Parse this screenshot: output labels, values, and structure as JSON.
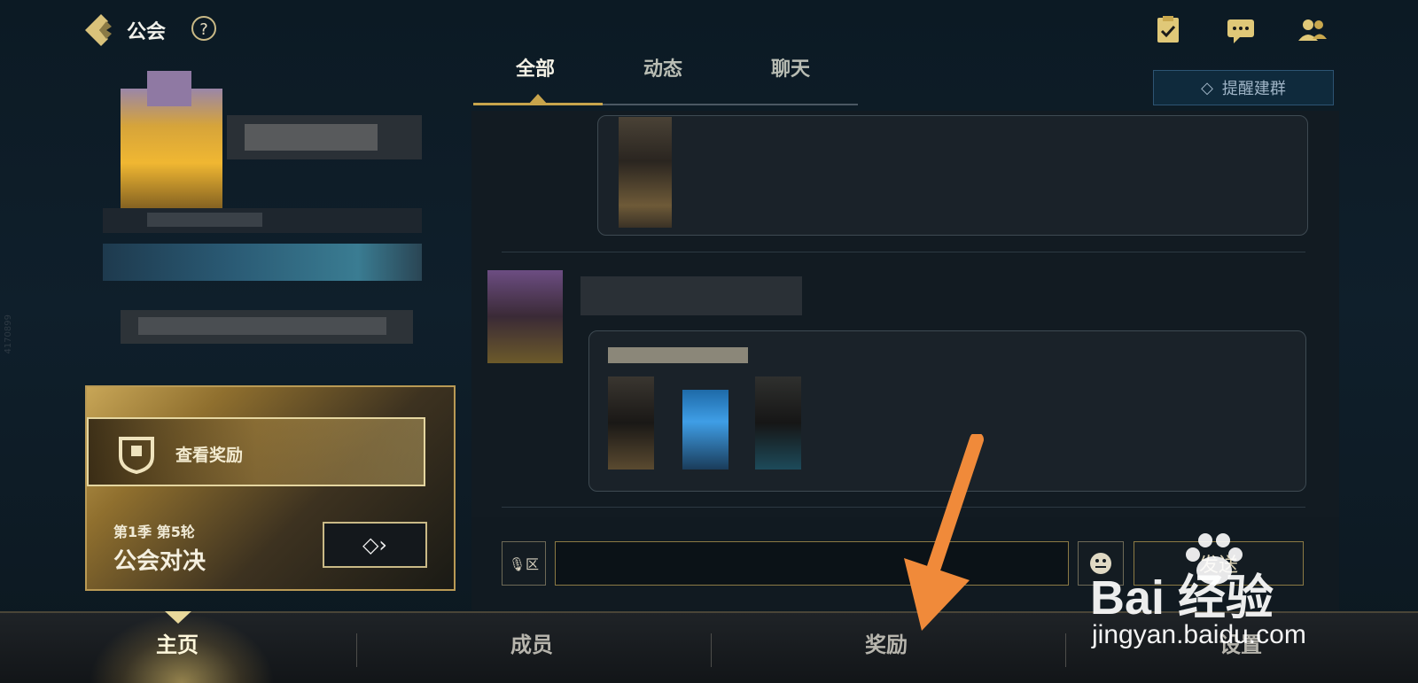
{
  "header": {
    "title": "公会",
    "help_label": "?",
    "icons": [
      "back-icon",
      "help-icon",
      "task-icon",
      "chat-icon",
      "members-icon"
    ]
  },
  "tabs": [
    {
      "label": "全部",
      "active": true
    },
    {
      "label": "动态",
      "active": false
    },
    {
      "label": "聊天",
      "active": false
    }
  ],
  "remind_button": "提醒建群",
  "guild_card": {
    "view_rewards": "查看奖励",
    "season": "第1季 第5轮",
    "name": "公会对决"
  },
  "input": {
    "voice_label": "🎙区",
    "send_label": "发送"
  },
  "bottom_nav": [
    {
      "label": "主页",
      "active": true
    },
    {
      "label": "成员",
      "active": false
    },
    {
      "label": "奖励",
      "active": false
    },
    {
      "label": "设置",
      "active": false
    }
  ],
  "side_id": "4170899",
  "watermark": {
    "logo": "Bai 经验",
    "url": "jingyan.baidu.com"
  },
  "colors": {
    "accent_gold": "#c8a54c",
    "arrow_orange": "#f08a3a",
    "background": "#0f1f2b"
  }
}
